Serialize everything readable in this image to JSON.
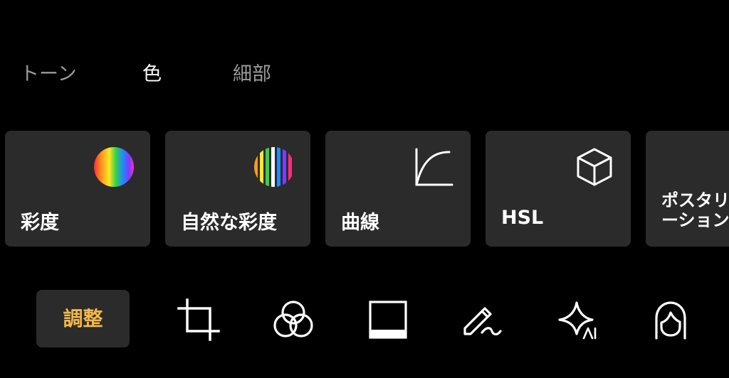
{
  "tabs": [
    {
      "label": "トーン"
    },
    {
      "label": "色"
    },
    {
      "label": "細部"
    }
  ],
  "active_tab_index": 1,
  "cards": [
    {
      "label": "彩度",
      "icon": "saturation-gradient-icon"
    },
    {
      "label": "自然な彩度",
      "icon": "vibrance-stripes-icon"
    },
    {
      "label": "曲線",
      "icon": "curve-icon"
    },
    {
      "label": "HSL",
      "icon": "cube-icon"
    },
    {
      "label": "ポスタリゼーション",
      "icon": "posterize-icon"
    }
  ],
  "toolbar": {
    "adjust_label": "調整",
    "tools": [
      {
        "name": "crop",
        "icon": "crop-icon"
      },
      {
        "name": "filter",
        "icon": "filter-circles-icon"
      },
      {
        "name": "frame",
        "icon": "frame-icon"
      },
      {
        "name": "draw",
        "icon": "pen-icon"
      },
      {
        "name": "ai",
        "icon": "ai-magic-icon"
      },
      {
        "name": "portrait",
        "icon": "portrait-icon"
      }
    ]
  },
  "colors": {
    "background": "#000000",
    "card": "#2b2b2b",
    "accent": "#f2b84b",
    "inactive_tab": "#9a9a9a"
  }
}
